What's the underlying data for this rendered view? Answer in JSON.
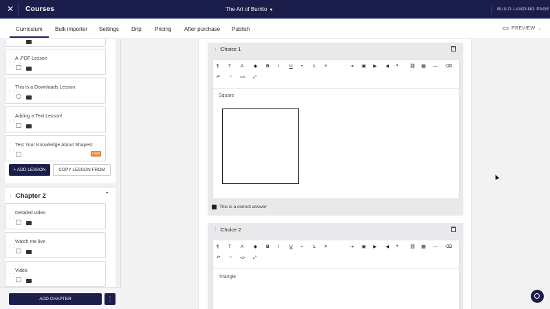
{
  "topbar": {
    "title": "Courses",
    "course_name": "The Art of Burrito",
    "landing_label": "BUILD LANDING PAGE",
    "close_glyph": "✕"
  },
  "tabs": [
    {
      "label": "Curriculum",
      "active": true
    },
    {
      "label": "Bulk importer"
    },
    {
      "label": "Settings"
    },
    {
      "label": "Drip"
    },
    {
      "label": "Pricing"
    },
    {
      "label": "After purchase"
    },
    {
      "label": "Publish"
    }
  ],
  "preview_label": "PREVIEW",
  "chapter1": {
    "lessons": [
      {
        "name": "A .PDF Lesson"
      },
      {
        "name": "This is a Downloads Lesson"
      },
      {
        "name": "Adding a Text Lesson!"
      },
      {
        "name": "Test Your Knowledge About Shapes!",
        "badge": "Draft"
      }
    ],
    "add_lesson": "ADD LESSON",
    "copy_lesson": "COPY LESSON FROM"
  },
  "chapter2": {
    "title": "Chapter 2",
    "lessons": [
      {
        "name": "Detailed video"
      },
      {
        "name": "Watch me live"
      },
      {
        "name": "Video"
      }
    ]
  },
  "sidebar_footer": {
    "add_chapter": "ADD CHAPTER",
    "more_glyph": "⋮"
  },
  "choices": [
    {
      "label": "Choice 1",
      "text": "Square",
      "correct_label": "This is a correct answer",
      "correct_checked": true
    },
    {
      "label": "Choice 2",
      "text": "Triangle"
    }
  ],
  "toolbar": {
    "row1": [
      "¶",
      "T",
      "A",
      "◆",
      "B",
      "I",
      "U",
      "•",
      "1.",
      "≡",
      "⇥",
      "▣",
      "▶",
      "◀",
      "❝",
      "⛓",
      "▦",
      "—",
      "⌫"
    ],
    "row2": [
      "↶",
      "↷",
      "</>",
      "⤢"
    ]
  },
  "colors": {
    "navy": "#1b1d4a",
    "draft_badge": "#e8833a"
  }
}
